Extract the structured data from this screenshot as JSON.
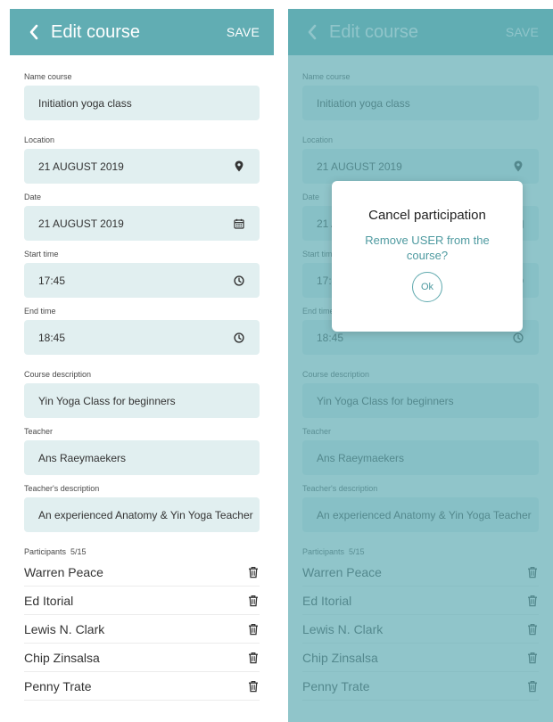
{
  "header": {
    "title": "Edit course",
    "save_label": "SAVE"
  },
  "form": {
    "name_label": "Name course",
    "name_value": "Initiation yoga class",
    "location_label": "Location",
    "location_value": "21 AUGUST 2019",
    "date_label": "Date",
    "date_value": "21 AUGUST 2019",
    "start_label": "Start time",
    "start_value": "17:45",
    "end_label": "End time",
    "end_value": "18:45",
    "description_label": "Course description",
    "description_value": "Yin Yoga Class for beginners",
    "teacher_label": "Teacher",
    "teacher_value": "Ans Raeymaekers",
    "teacher_desc_label": "Teacher's description",
    "teacher_desc_value": "An experienced Anatomy & Yin Yoga Teacher"
  },
  "participants": {
    "label": "Participants",
    "count": "5/15",
    "items": [
      {
        "name": "Warren Peace"
      },
      {
        "name": "Ed Itorial"
      },
      {
        "name": "Lewis N. Clark"
      },
      {
        "name": "Chip Zinsalsa"
      },
      {
        "name": "Penny Trate"
      }
    ]
  },
  "dialog": {
    "title": "Cancel participation",
    "message": "Remove USER from the course?",
    "ok_label": "Ok"
  },
  "icons": {
    "back": "chevron-left-icon",
    "location": "map-pin-icon",
    "date": "calendar-icon",
    "time": "clock-icon",
    "delete": "trash-icon"
  },
  "colors": {
    "header": "#61adb3",
    "field": "#e1eff0",
    "accent": "#4e9aa0"
  }
}
